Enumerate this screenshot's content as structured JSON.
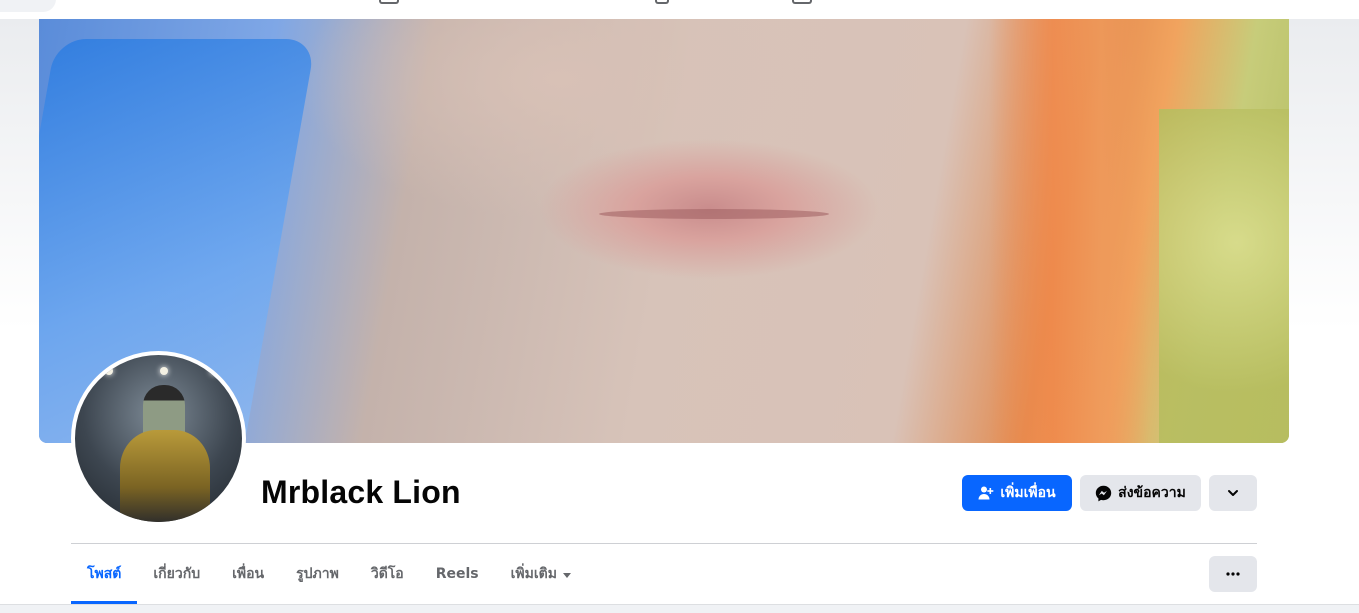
{
  "profile": {
    "name": "Mrblack Lion"
  },
  "actions": {
    "add_friend_label": "เพิ่มเพื่อน",
    "message_label": "ส่งข้อความ"
  },
  "tabs": [
    {
      "label": "โพสต์",
      "active": true
    },
    {
      "label": "เกี่ยวกับ",
      "active": false
    },
    {
      "label": "เพื่อน",
      "active": false
    },
    {
      "label": "รูปภาพ",
      "active": false
    },
    {
      "label": "วิดีโอ",
      "active": false
    },
    {
      "label": "Reels",
      "active": false
    },
    {
      "label": "เพิ่มเติม",
      "active": false
    }
  ],
  "colors": {
    "accent": "#0866ff",
    "secondary_button": "#e4e6eb",
    "text_primary": "#050505",
    "text_secondary": "#65676b"
  },
  "icons": {
    "add_friend": "person-plus-icon",
    "message": "messenger-icon",
    "expand": "chevron-down-icon",
    "more": "ellipsis-icon"
  }
}
